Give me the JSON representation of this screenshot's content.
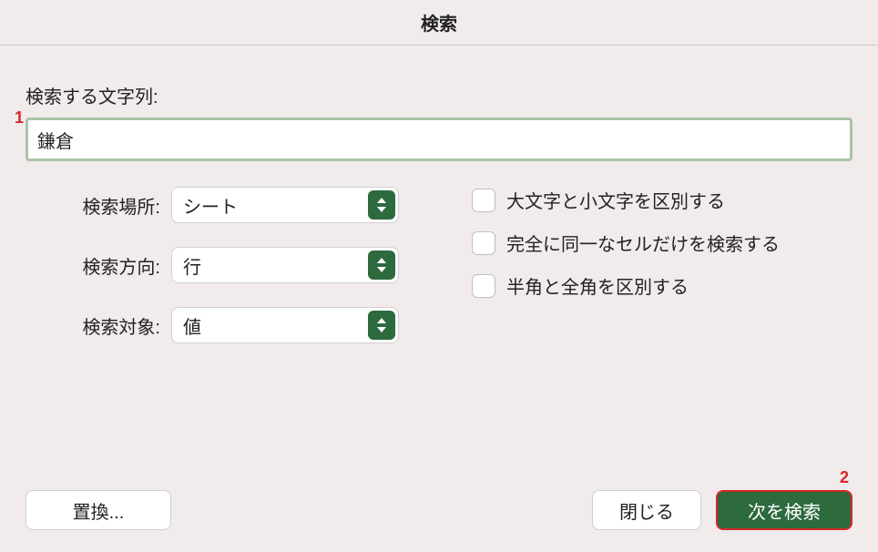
{
  "title": "検索",
  "search": {
    "label": "検索する文字列:",
    "value": "鎌倉"
  },
  "selects": {
    "location": {
      "label": "検索場所:",
      "value": "シート"
    },
    "direction": {
      "label": "検索方向:",
      "value": "行"
    },
    "target": {
      "label": "検索対象:",
      "value": "値"
    }
  },
  "checkboxes": {
    "matchCase": "大文字と小文字を区別する",
    "matchEntire": "完全に同一なセルだけを検索する",
    "matchWidth": "半角と全角を区別する"
  },
  "buttons": {
    "replace": "置換...",
    "close": "閉じる",
    "findNext": "次を検索"
  },
  "markers": {
    "m1": "1",
    "m2": "2"
  }
}
